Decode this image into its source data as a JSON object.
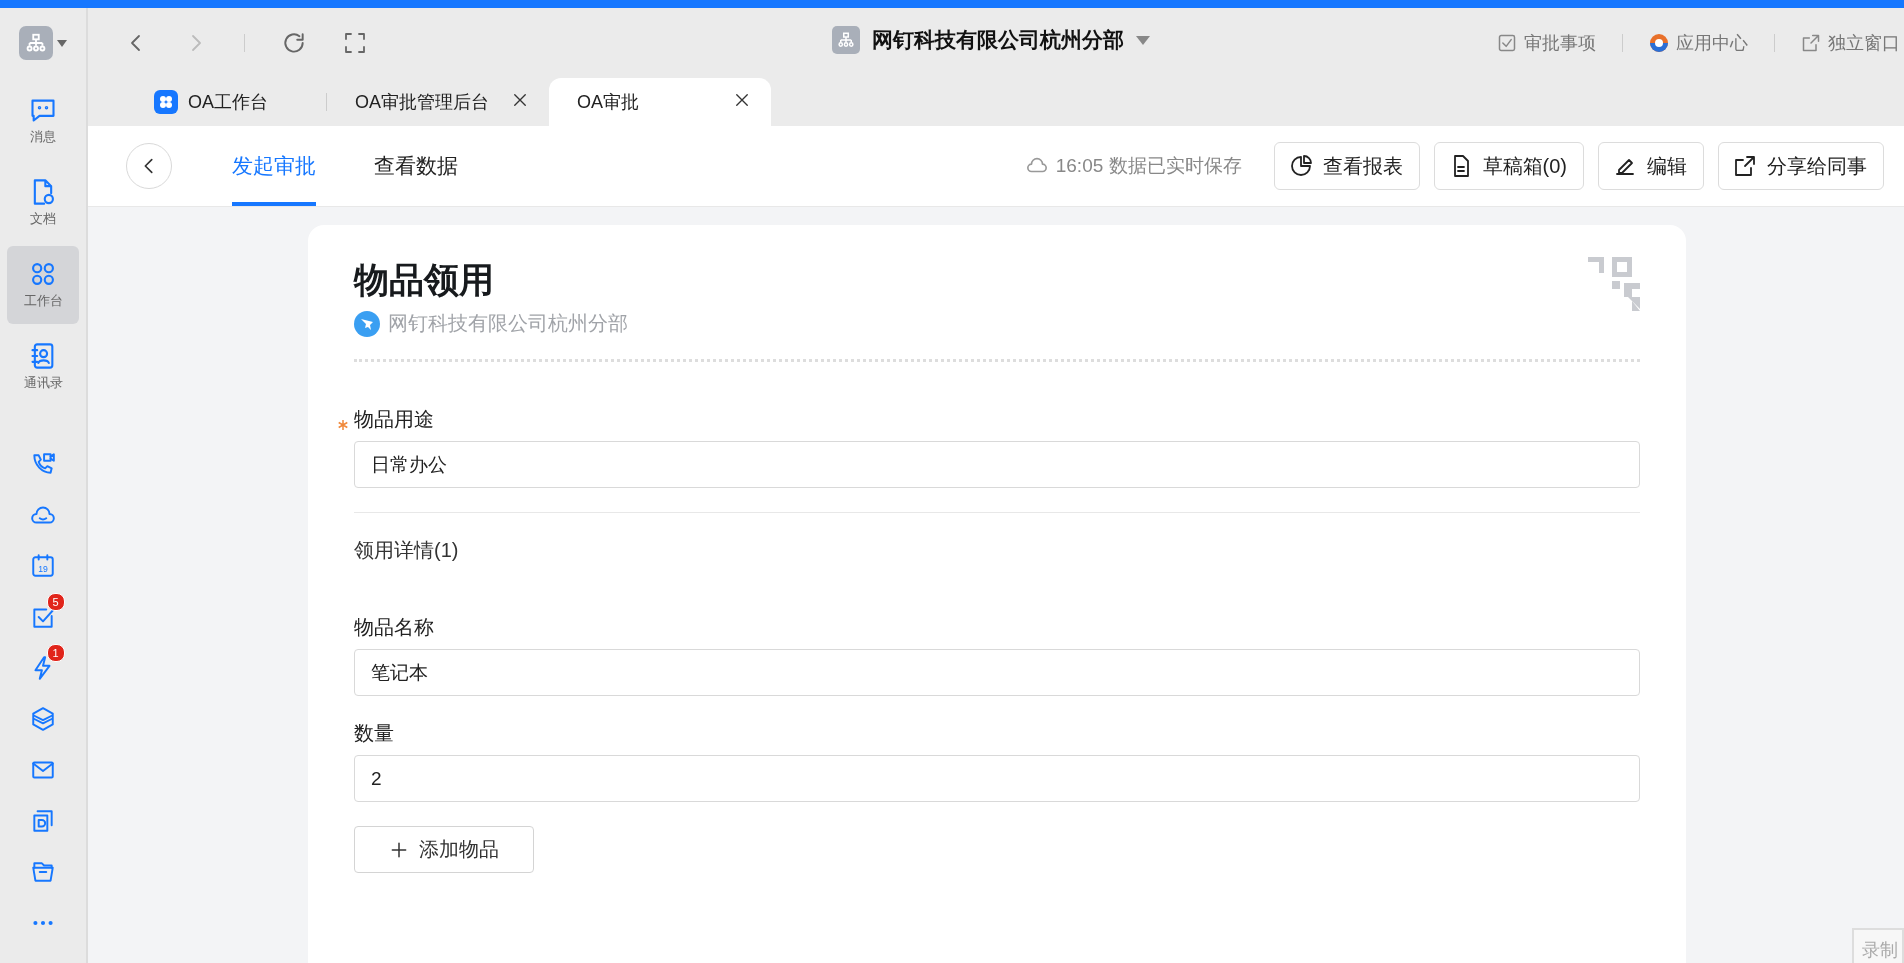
{
  "sidebar": {
    "items": [
      {
        "label": "消息",
        "kind": "chat",
        "selected": false
      },
      {
        "label": "文档",
        "kind": "doc",
        "selected": false
      },
      {
        "label": "工作台",
        "kind": "grid",
        "selected": true
      },
      {
        "label": "通讯录",
        "kind": "contacts",
        "selected": false
      }
    ],
    "tools": [
      {
        "kind": "call"
      },
      {
        "kind": "cloud"
      },
      {
        "kind": "calendar",
        "day": "19"
      },
      {
        "kind": "todo",
        "badge": "5"
      },
      {
        "kind": "flash",
        "badge": "1"
      },
      {
        "kind": "layers"
      },
      {
        "kind": "mail"
      },
      {
        "kind": "docs"
      },
      {
        "kind": "folder"
      },
      {
        "kind": "more"
      }
    ]
  },
  "org": {
    "name": "网钉科技有限公司杭州分部"
  },
  "top_links": [
    {
      "label": "审批事项",
      "kind": "check"
    },
    {
      "label": "应用中心",
      "kind": "apps"
    },
    {
      "label": "独立窗口",
      "kind": "popout"
    }
  ],
  "tabs": [
    {
      "label": "OA工作台",
      "selected": false,
      "closable": false
    },
    {
      "label": "OA审批管理后台",
      "selected": false,
      "closable": true
    },
    {
      "label": "OA审批",
      "selected": true,
      "closable": true
    }
  ],
  "page_tabs": [
    {
      "label": "发起审批",
      "selected": true
    },
    {
      "label": "查看数据",
      "selected": false
    }
  ],
  "save_status": "16:05 数据已实时保存",
  "actions": [
    {
      "label": "查看报表",
      "kind": "report"
    },
    {
      "label": "草稿箱(0)",
      "kind": "draft"
    },
    {
      "label": "编辑",
      "kind": "edit"
    },
    {
      "label": "分享给同事",
      "kind": "share"
    }
  ],
  "form": {
    "title": "物品领用",
    "org": "网钉科技有限公司杭州分部",
    "fields": [
      {
        "label": "物品用途",
        "required": true,
        "value": "日常办公"
      }
    ],
    "detail": {
      "title": "领用详情(1)",
      "fields": [
        {
          "label": "物品名称",
          "required": false,
          "value": "笔记本"
        },
        {
          "label": "数量",
          "required": false,
          "value": "2"
        }
      ],
      "add_button": "添加物品"
    }
  },
  "recorder": {
    "label": "录制"
  }
}
